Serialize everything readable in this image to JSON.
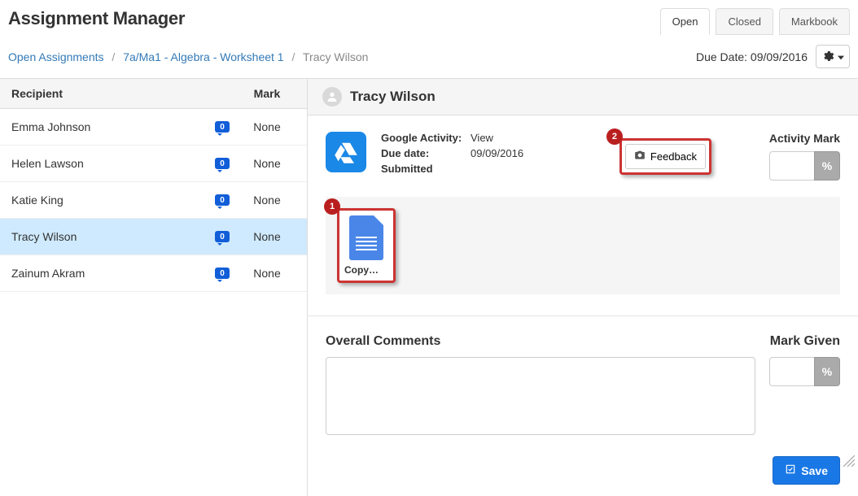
{
  "page": {
    "title": "Assignment Manager"
  },
  "tabs": {
    "open": "Open",
    "closed": "Closed",
    "markbook": "Markbook"
  },
  "breadcrumb": {
    "l1": "Open Assignments",
    "l2": "7a/Ma1 - Algebra - Worksheet 1",
    "l3": "Tracy Wilson"
  },
  "due": {
    "label": "Due Date:",
    "value": "09/09/2016"
  },
  "sidebar": {
    "cols": {
      "recipient": "Recipient",
      "mark": "Mark"
    },
    "rows": [
      {
        "name": "Emma Johnson",
        "count": "0",
        "mark": "None"
      },
      {
        "name": "Helen Lawson",
        "count": "0",
        "mark": "None"
      },
      {
        "name": "Katie King",
        "count": "0",
        "mark": "None"
      },
      {
        "name": "Tracy Wilson",
        "count": "0",
        "mark": "None"
      },
      {
        "name": "Zainum Akram",
        "count": "0",
        "mark": "None"
      }
    ]
  },
  "student": {
    "name": "Tracy Wilson"
  },
  "activity": {
    "labels": {
      "ga": "Google Activity:",
      "due": "Due date:",
      "sub": "Submitted"
    },
    "values": {
      "ga": "View",
      "due": "09/09/2016"
    }
  },
  "feedback": {
    "label": "Feedback"
  },
  "markcol": {
    "label": "Activity Mark",
    "pct": "%"
  },
  "doc": {
    "label": "Copy…"
  },
  "comments": {
    "overall": "Overall Comments",
    "markgiven": "Mark Given",
    "pct": "%"
  },
  "save": {
    "label": "Save"
  },
  "callouts": {
    "one": "1",
    "two": "2"
  }
}
